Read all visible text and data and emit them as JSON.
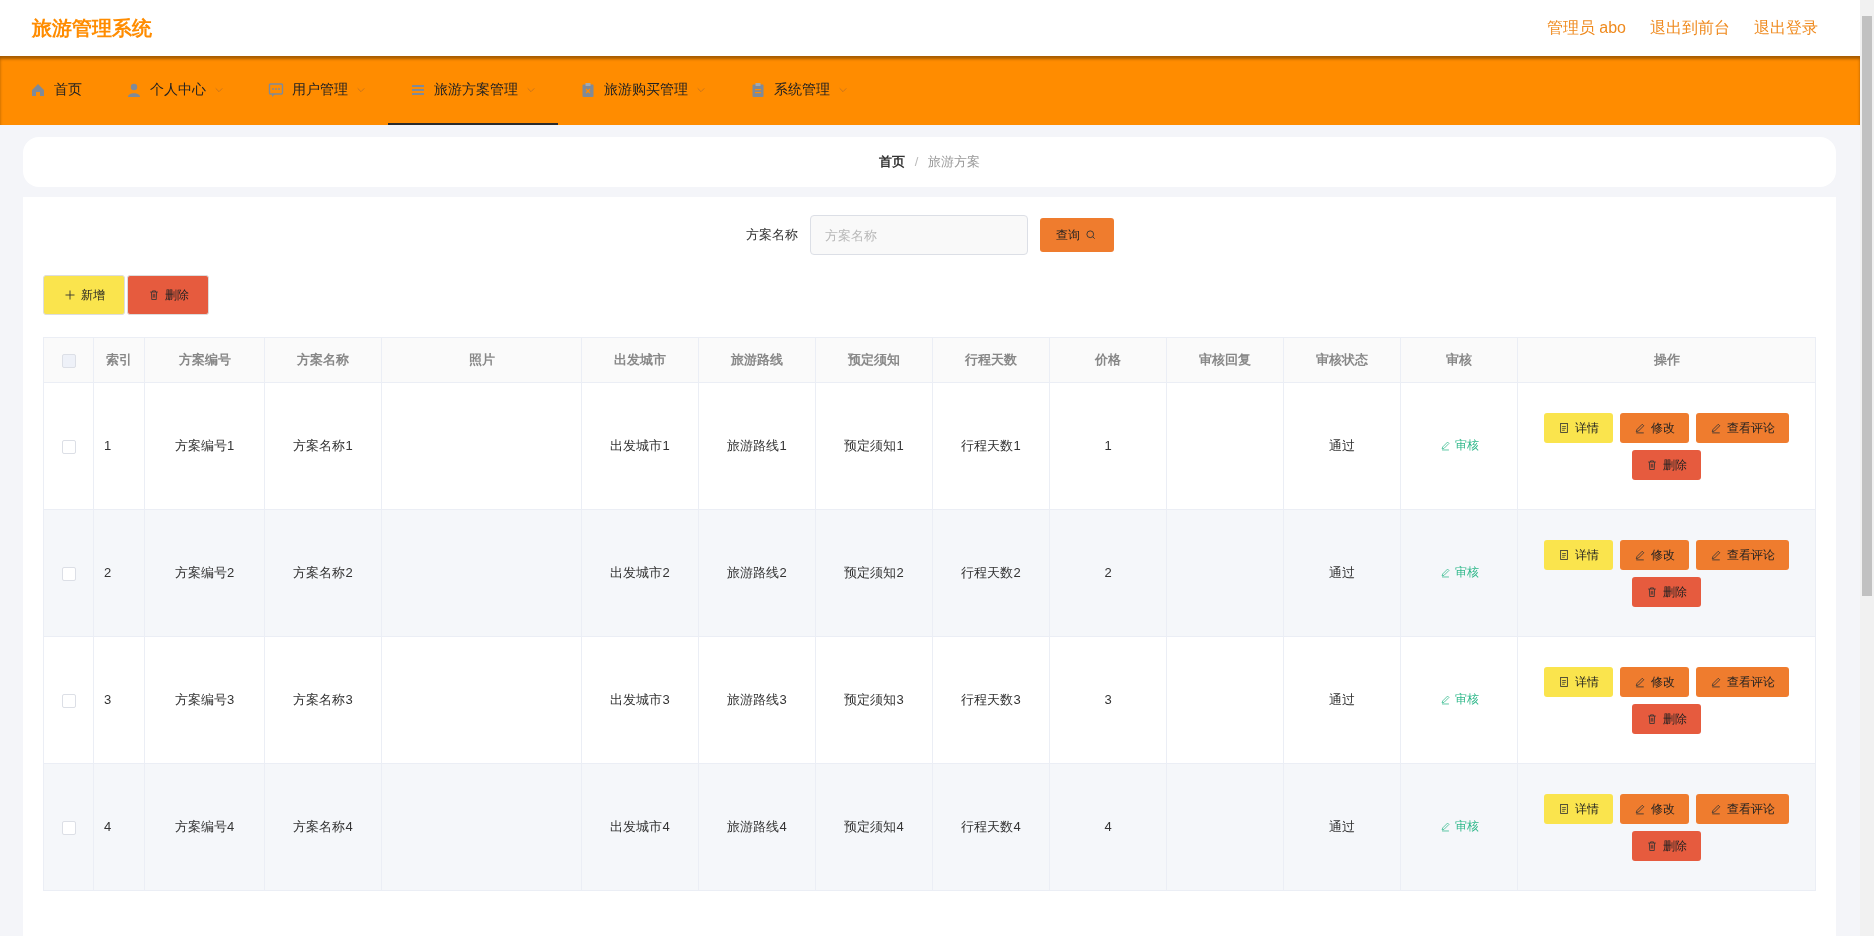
{
  "header": {
    "title": "旅游管理系统",
    "links": [
      "管理员 abo",
      "退出到前台",
      "退出登录"
    ]
  },
  "nav": [
    {
      "label": "首页",
      "dropdown": false,
      "selected": false
    },
    {
      "label": "个人中心",
      "dropdown": true,
      "selected": false
    },
    {
      "label": "用户管理",
      "dropdown": true,
      "selected": false
    },
    {
      "label": "旅游方案管理",
      "dropdown": true,
      "selected": true
    },
    {
      "label": "旅游购买管理",
      "dropdown": true,
      "selected": false
    },
    {
      "label": "系统管理",
      "dropdown": true,
      "selected": false
    }
  ],
  "breadcrumb": {
    "items": [
      "首页",
      "旅游方案"
    ],
    "separator": "/"
  },
  "search": {
    "label": "方案名称",
    "placeholder": "方案名称",
    "button": "查询"
  },
  "actions": [
    {
      "label": "新增",
      "kind": "add"
    },
    {
      "label": "删除",
      "kind": "delete"
    }
  ],
  "table": {
    "all_checked": false,
    "columns": [
      "索引",
      "方案编号",
      "方案名称",
      "照片",
      "出发城市",
      "旅游路线",
      "预定须知",
      "行程天数",
      "价格",
      "审核回复",
      "审核状态",
      "审核",
      "操作"
    ],
    "rows": [
      {
        "checked": false,
        "index": "1",
        "code": "方案编号1",
        "name": "方案名称1",
        "city": "出发城市1",
        "route": "旅游路线1",
        "notice": "预定须知1",
        "days": "行程天数1",
        "price": "1",
        "status": "通过",
        "review": "审核",
        "buttons": [
          {
            "label": "详情",
            "kind": "detail"
          },
          {
            "label": "修改",
            "kind": "edit"
          },
          {
            "label": "查看评论",
            "kind": "comment"
          },
          {
            "label": "删除",
            "kind": "delete"
          }
        ]
      },
      {
        "checked": false,
        "index": "2",
        "code": "方案编号2",
        "name": "方案名称2",
        "city": "出发城市2",
        "route": "旅游路线2",
        "notice": "预定须知2",
        "days": "行程天数2",
        "price": "2",
        "status": "通过",
        "review": "审核",
        "buttons": [
          {
            "label": "详情",
            "kind": "detail"
          },
          {
            "label": "修改",
            "kind": "edit"
          },
          {
            "label": "查看评论",
            "kind": "comment"
          },
          {
            "label": "删除",
            "kind": "delete"
          }
        ]
      },
      {
        "checked": false,
        "index": "3",
        "code": "方案编号3",
        "name": "方案名称3",
        "city": "出发城市3",
        "route": "旅游路线3",
        "notice": "预定须知3",
        "days": "行程天数3",
        "price": "3",
        "status": "通过",
        "review": "审核",
        "buttons": [
          {
            "label": "详情",
            "kind": "detail"
          },
          {
            "label": "修改",
            "kind": "edit"
          },
          {
            "label": "查看评论",
            "kind": "comment"
          },
          {
            "label": "删除",
            "kind": "delete"
          }
        ]
      },
      {
        "checked": false,
        "index": "4",
        "code": "方案编号4",
        "name": "方案名称4",
        "city": "出发城市4",
        "route": "旅游路线4",
        "notice": "预定须知4",
        "days": "行程天数4",
        "price": "4",
        "status": "通过",
        "review": "审核",
        "buttons": [
          {
            "label": "详情",
            "kind": "detail"
          },
          {
            "label": "修改",
            "kind": "edit"
          },
          {
            "label": "查看评论",
            "kind": "comment"
          },
          {
            "label": "删除",
            "kind": "delete"
          }
        ]
      }
    ]
  }
}
